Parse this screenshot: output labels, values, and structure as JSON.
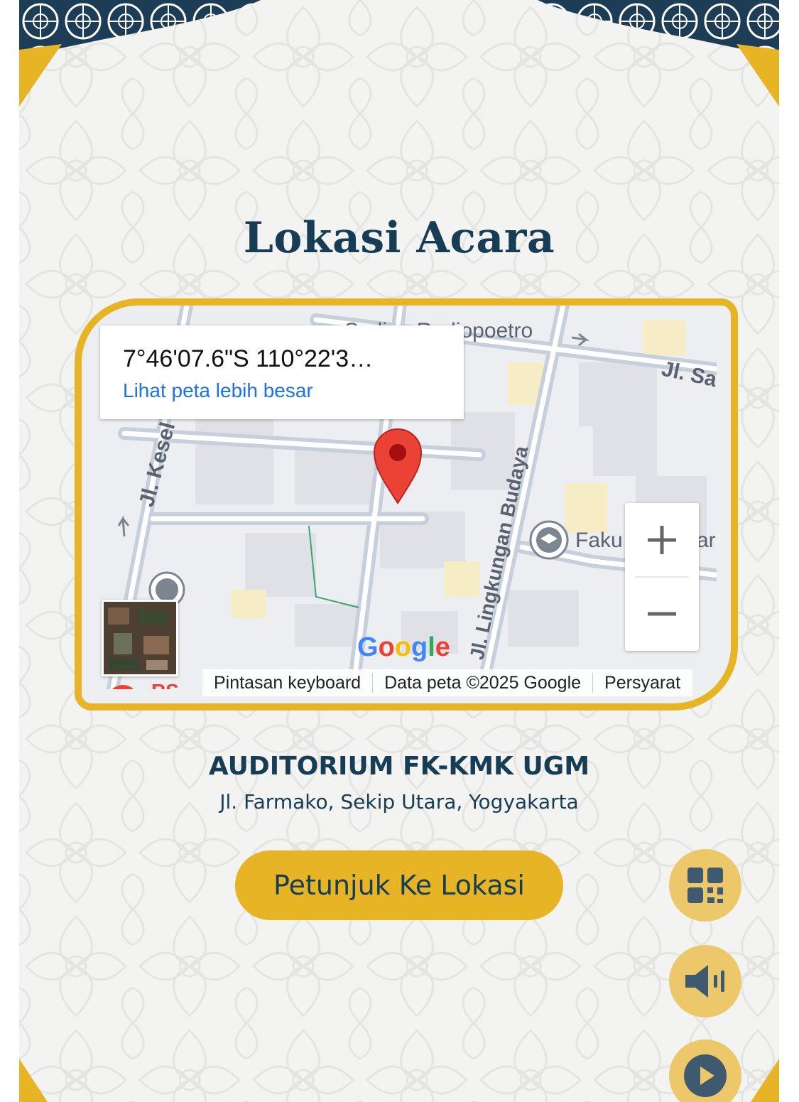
{
  "section": {
    "title": "Lokasi Acara"
  },
  "map": {
    "coordinates": "7°46'07.6\"S 110°22'3…",
    "view_larger_link": "Lihat peta lebih besar",
    "street_labels": {
      "top": "Sadjoe Radjopoetro",
      "top_right": "Jl. Sa",
      "left": "Jl. Kesel",
      "middle": "Jl. Lingkungan Budaya",
      "poi": "Faku",
      "poi_right": "ar",
      "bottom": "RS"
    },
    "zoom_in_label": "+",
    "zoom_out_label": "−",
    "google_logo": [
      "G",
      "o",
      "o",
      "g",
      "l",
      "e"
    ],
    "attribution": {
      "shortcuts": "Pintasan keyboard",
      "data": "Data peta ©2025 Google",
      "terms": "Persyarat"
    }
  },
  "venue": {
    "name": "AUDITORIUM FK-KMK UGM",
    "address": "Jl. Farmako, Sekip Utara, Yogyakarta"
  },
  "directions_button": "Petunjuk Ke Lokasi",
  "fabs": {
    "qr": "qr-code-icon",
    "sound": "speaker-icon",
    "play": "play-icon"
  },
  "colors": {
    "navy": "#173d55",
    "gold": "#e7b425",
    "map_pin": "#ea4335",
    "link_blue": "#1a73e8"
  }
}
